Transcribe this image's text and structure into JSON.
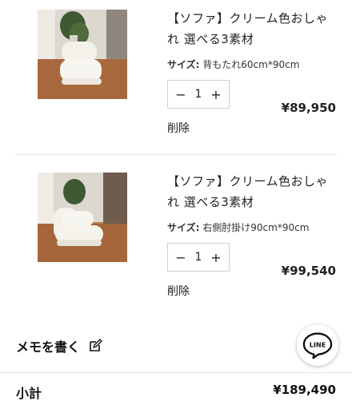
{
  "cart": {
    "items": [
      {
        "title": "【ソファ】クリーム色おしゃれ 選べる3素材",
        "variant_label": "サイズ:",
        "variant_value": "背もたれ60cm*90cm",
        "quantity": "1",
        "minus": "−",
        "plus": "+",
        "price": "¥89,950",
        "remove_label": "削除",
        "image": "sofa-backrest-photo"
      },
      {
        "title": "【ソファ】クリーム色おしゃれ 選べる3素材",
        "variant_label": "サイズ:",
        "variant_value": "右側肘掛け90cm*90cm",
        "quantity": "1",
        "minus": "−",
        "plus": "+",
        "price": "¥99,540",
        "remove_label": "削除",
        "image": "sofa-armrest-photo"
      }
    ]
  },
  "memo": {
    "label": "メモを書く",
    "icon": "edit-icon"
  },
  "line_button": {
    "label": "LINE",
    "icon": "line-chat-icon",
    "color": "#111111"
  },
  "summary": {
    "subtotal_label": "小計",
    "subtotal_value": "¥189,490"
  }
}
